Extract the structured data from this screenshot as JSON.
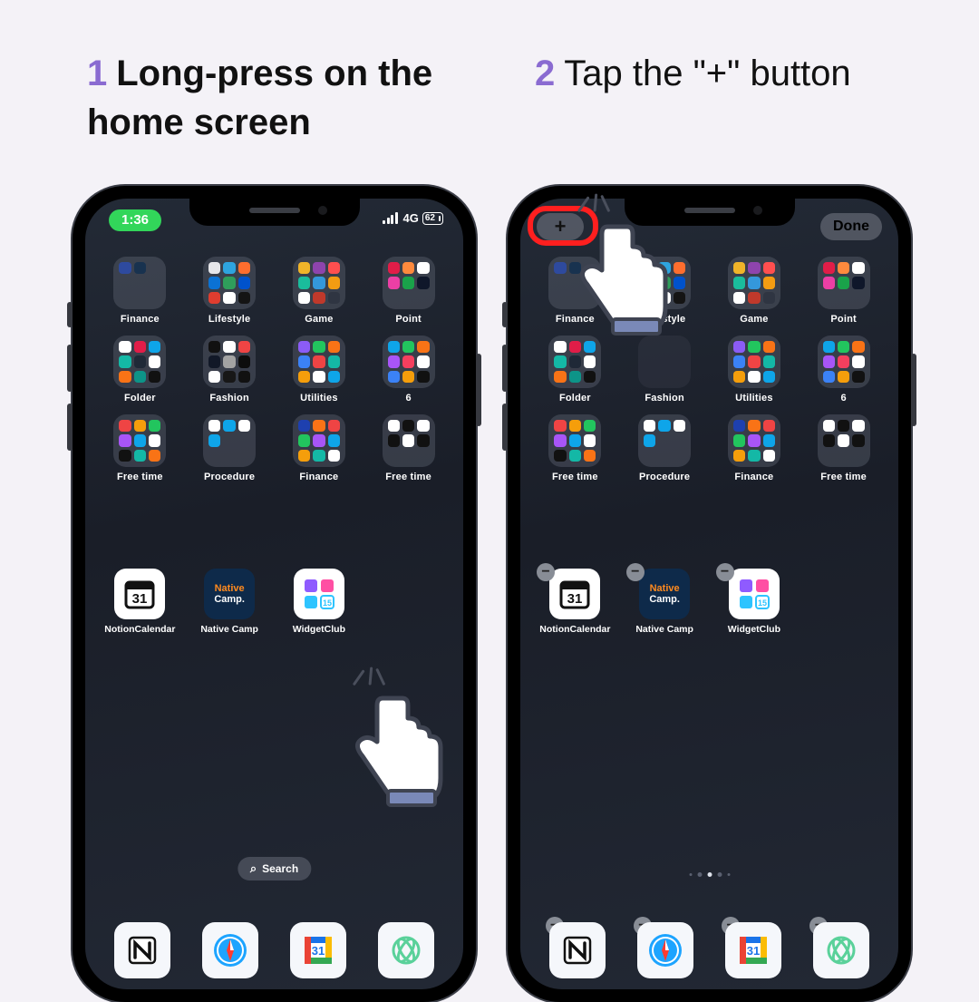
{
  "steps": [
    {
      "number": "1",
      "text": "Long-press on the home screen"
    },
    {
      "number": "2",
      "text": "Tap the \"+\" button"
    }
  ],
  "status": {
    "time": "1:36",
    "net": "4G",
    "battery": "62"
  },
  "editBar": {
    "plus": "+",
    "done": "Done"
  },
  "folderRows": [
    [
      "Finance",
      "Lifestyle",
      "Game",
      "Point"
    ],
    [
      "Folder",
      "Fashion",
      "Utilities",
      "6"
    ],
    [
      "Free time",
      "Procedure",
      "Finance",
      "Free time"
    ]
  ],
  "apps": [
    {
      "label": "NotionCalendar"
    },
    {
      "label": "Native Camp"
    },
    {
      "label": "WidgetClub"
    }
  ],
  "search": "Search",
  "dock": [
    "notion",
    "safari",
    "gcal",
    "claude"
  ],
  "miniColors": [
    [
      "#2e4a9e",
      "#18324f"
    ],
    [
      "#e6e6ea",
      "#2ea4df",
      "#ff6e2e",
      "#0b72d4",
      "#2f9e5b",
      "#0052cc",
      "#e03d2f",
      "#ffffff",
      "#141414"
    ],
    [
      "#f0b429",
      "#8e44ad",
      "#ff4f4f",
      "#1abc9c",
      "#3498db",
      "#f39c12",
      "#ffffff",
      "#c0392b",
      "#2f3542"
    ],
    [
      "#e11d48",
      "#ff8a3d",
      "#ffffff",
      "#ec3fa5",
      "#1aa34a",
      "#0f172a"
    ],
    [
      "#ffffff",
      "#e11d48",
      "#0ea5e9",
      "#14b8a6",
      "#1f2937",
      "#ffffff",
      "#f97316",
      "#0d9488",
      "#111111"
    ],
    [
      "#111111",
      "#ffffff",
      "#ef4444",
      "#111827",
      "#a3a3a3",
      "#0d0d0d",
      "#ffffff",
      "#171717",
      "#111111"
    ],
    [
      "#8b5cf6",
      "#22c55e",
      "#f97316",
      "#3b82f6",
      "#ef4444",
      "#14b8a6",
      "#f59e0b",
      "#ffffff",
      "#0ea5e9"
    ],
    [
      "#0ea5e9",
      "#22c55e",
      "#f97316",
      "#a855f7",
      "#f43f5e",
      "#ffffff",
      "#3b82f6",
      "#f59e0b",
      "#111111"
    ],
    [
      "#ef4444",
      "#f59e0b",
      "#22c55e",
      "#a855f7",
      "#0ea5e9",
      "#ffffff",
      "#111111",
      "#14b8a6",
      "#f97316"
    ],
    [
      "#ffffff",
      "#0ea5e9",
      "#ffffff",
      "#0ea5e9"
    ],
    [
      "#1e40af",
      "#f97316",
      "#ef4444",
      "#22c55e",
      "#a855f7",
      "#0ea5e9",
      "#f59e0b",
      "#14b8a6",
      "#ffffff"
    ],
    [
      "#ffffff",
      "#111111",
      "#ffffff",
      "#111111",
      "#ffffff",
      "#111111"
    ]
  ]
}
